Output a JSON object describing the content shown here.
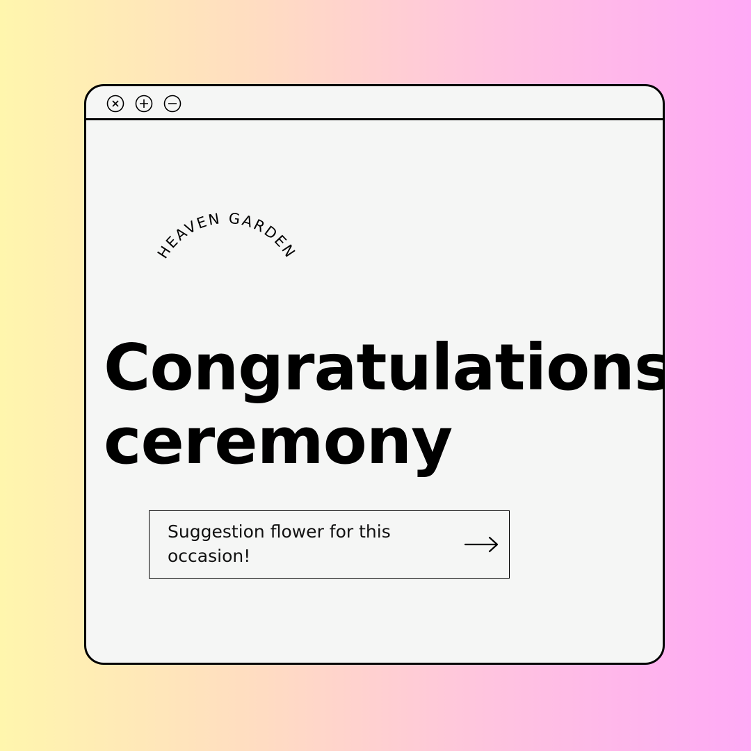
{
  "window": {
    "controls": {
      "close_icon": "close-icon",
      "maximize_icon": "plus-icon",
      "minimize_icon": "minus-icon"
    }
  },
  "brand": {
    "name": "HEAVEN GARDEN"
  },
  "headline": {
    "line1": "Congratulations",
    "line2": "ceremony"
  },
  "cta": {
    "label": "Suggestion flower for this occasion!",
    "icon": "arrow-right-icon"
  },
  "colors": {
    "gradient_start": "#fff6ad",
    "gradient_end": "#ffa9f6",
    "window_bg": "#f5f6f5",
    "ink": "#000000"
  }
}
